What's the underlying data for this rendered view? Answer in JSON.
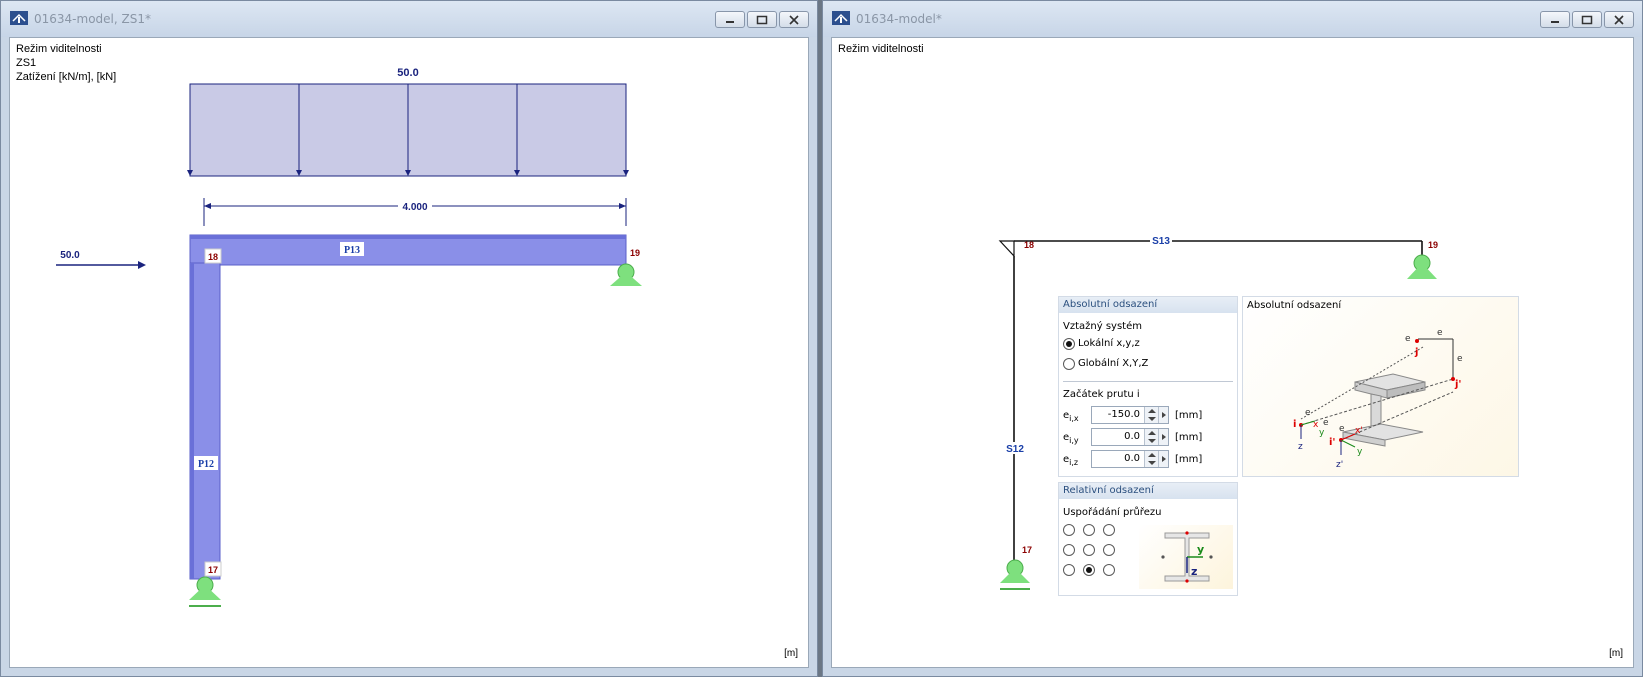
{
  "left_window": {
    "title": "01634-model, ZS1*",
    "info_line1": "Režim viditelnosti",
    "info_line2": "ZS1",
    "info_line3": "Zatížení [kN/m], [kN]",
    "unit_label": "[m]",
    "model": {
      "distributed_load_value": "50.0",
      "point_load_value": "50.0",
      "dimension_value": "4.000",
      "member_horizontal": "P13",
      "member_vertical": "P12",
      "node_top_left": "18",
      "node_top_right": "19",
      "node_bottom": "17"
    }
  },
  "right_window": {
    "title": "01634-model*",
    "info_line1": "Režim viditelnosti",
    "unit_label": "[m]",
    "model": {
      "member_horizontal": "S13",
      "member_vertical": "S12",
      "node_top_left": "18",
      "node_top_right": "19",
      "node_bottom": "17"
    },
    "dialog": {
      "abs_header": "Absolutní odsazení",
      "ref_system_label": "Vztažný systém",
      "local_label": "Lokální x,y,z",
      "global_label": "Globální X,Y,Z",
      "member_start_label": "Začátek prutu i",
      "fields": [
        {
          "label_main": "e",
          "label_sub": "i,x",
          "value": "-150.0",
          "unit": "[mm]"
        },
        {
          "label_main": "e",
          "label_sub": "i,y",
          "value": "0.0",
          "unit": "[mm]"
        },
        {
          "label_main": "e",
          "label_sub": "i,z",
          "value": "0.0",
          "unit": "[mm]"
        }
      ],
      "image_title": "Absolutní odsazení",
      "rel_header": "Relativní odsazení",
      "cross_section_label": "Uspořádání průřezu",
      "diagram_labels": {
        "ex": "e",
        "ey": "e",
        "ez": "e",
        "j": "j",
        "j_prime": "j'",
        "i": "i",
        "i_prime": "i'",
        "x": "x",
        "y": "y",
        "z": "z",
        "x_prime": "x'",
        "y_prime": "y",
        "z_prime": "z'"
      },
      "section_axis_y": "y",
      "section_axis_z": "z"
    }
  },
  "colors": {
    "member_fill": "#8a8fe8",
    "load_fill": "#c9cae6",
    "load_line": "#1a237e",
    "support": "#7ee07e",
    "node_text": "#8b0000",
    "label_blue": "#1a3fa8"
  }
}
